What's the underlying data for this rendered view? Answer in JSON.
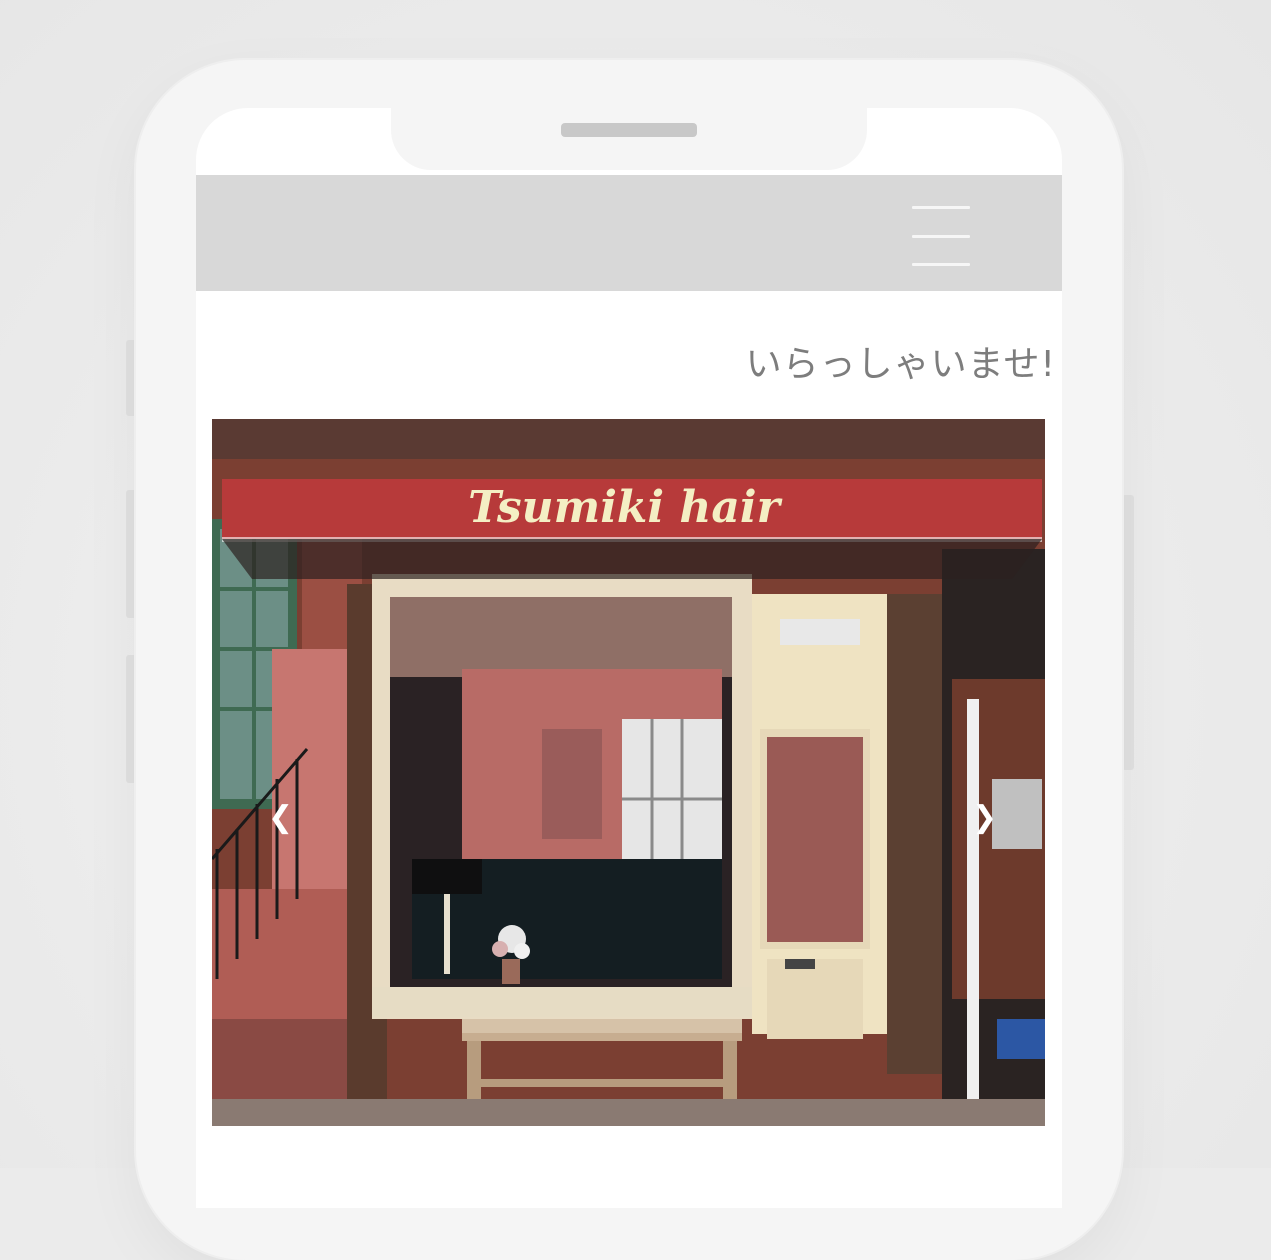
{
  "header": {
    "menu_icon": "hamburger-menu-icon"
  },
  "main": {
    "greeting": "いらっしゃいませ!"
  },
  "carousel": {
    "awning_text": "Tsumiki hair",
    "prev_icon": "chevron-left-icon",
    "next_icon": "chevron-right-icon",
    "prev_glyph": "❮",
    "next_glyph": "❯"
  },
  "colors": {
    "awning": "#b73a3a",
    "awning_top": "#f08fb0",
    "awning_text": "#f4efc4",
    "header_bg": "#d8d8d8",
    "greeting": "#7d7d7d"
  }
}
